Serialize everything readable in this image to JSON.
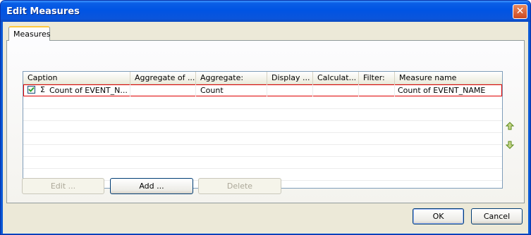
{
  "window": {
    "title": "Edit Measures",
    "close_glyph": "✕"
  },
  "tabs": [
    {
      "label": "Measures"
    }
  ],
  "grid": {
    "columns": [
      "Caption",
      "Aggregate of ...",
      "Aggregate:",
      "Display ...",
      "Calculat...",
      "Filter:",
      "Measure name"
    ],
    "rows": [
      {
        "checked": true,
        "caption": "Count of EVENT_N...",
        "aggregate_of": "",
        "aggregate": "Count",
        "display": "",
        "calculated": "",
        "filter": "",
        "measure_name": "Count of EVENT_NAME"
      }
    ]
  },
  "sigma_glyph": "Σ",
  "icons": {
    "move_up": "arrow-up-icon",
    "move_down": "arrow-down-icon",
    "check": "checkmark-icon",
    "sum": "sigma-icon",
    "close": "close-icon"
  },
  "colors": {
    "titlebar": "#0054e3",
    "selection_outline": "#e00000",
    "arrow_green": "#5a8a1c",
    "dialog_bg": "#ece9d8"
  },
  "buttons": {
    "edit": "Edit ...",
    "add": "Add ...",
    "delete": "Delete",
    "ok": "OK",
    "cancel": "Cancel"
  }
}
